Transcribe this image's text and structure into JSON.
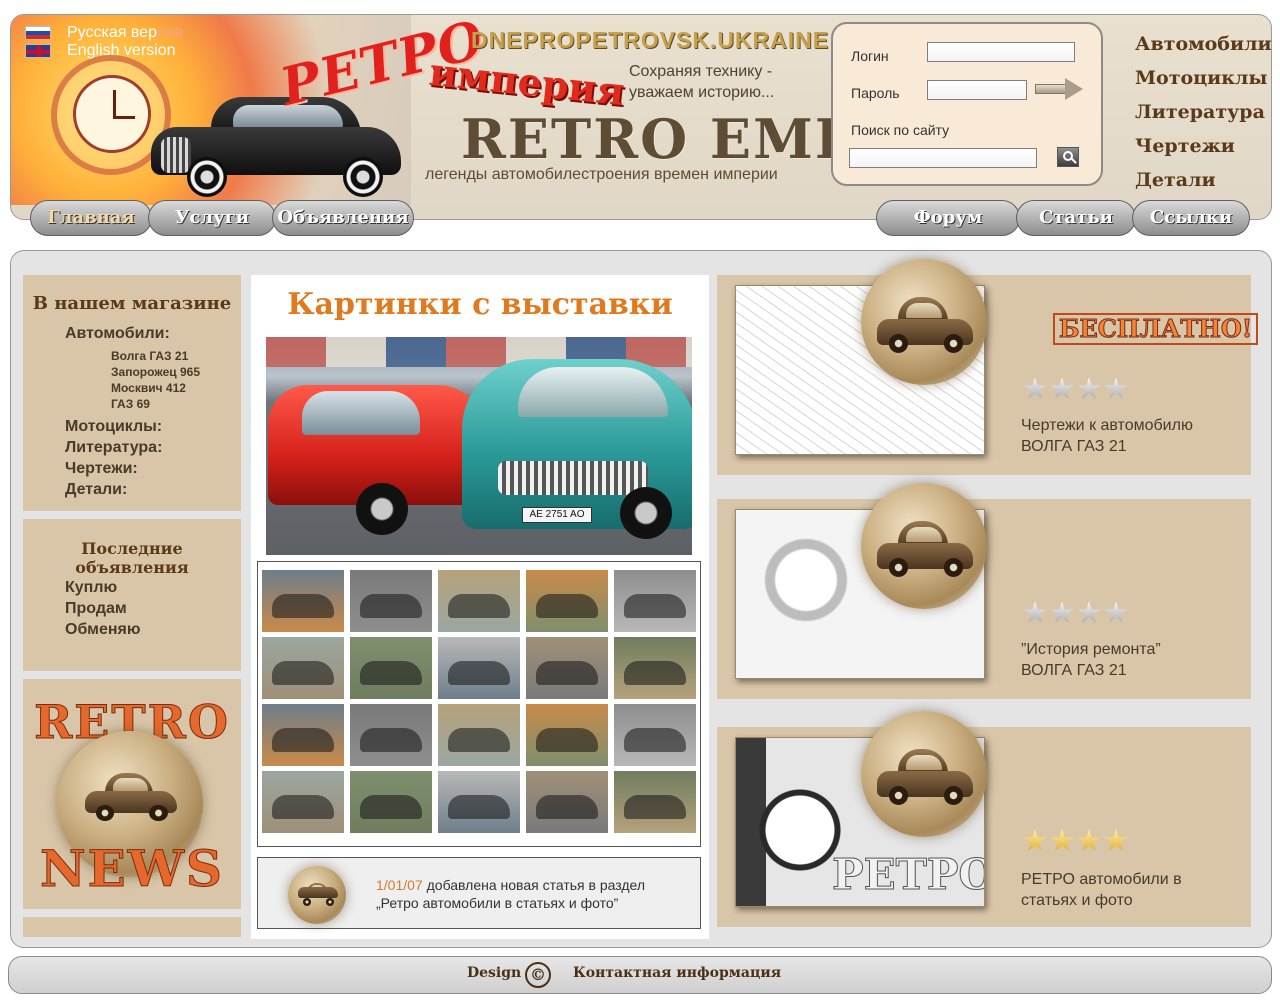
{
  "languages": [
    {
      "label": "Русская вер",
      "accent": "сия",
      "flag": "ru-flag-icon"
    },
    {
      "label": "English version",
      "accent": "",
      "flag": "uk-flag-icon"
    }
  ],
  "header": {
    "title_retro": "РЕТРО",
    "title_imperia": "империя",
    "location": "DNEPROPETROVSK.UKRAINE",
    "slogan_line1": "Сохраняя технику -",
    "slogan_line2": "уважаем историю...",
    "brand": "RETRO EMPIRE",
    "tagline": "легенды автомобилестроения времен империи"
  },
  "login": {
    "login_label": "Логин",
    "login_value": "",
    "password_label": "Пароль",
    "password_value": "",
    "search_label": "Поиск по сайту",
    "search_value": ""
  },
  "top_menu": [
    "Автомобили",
    "Мотоциклы",
    "Литература",
    "Чертежи",
    "Детали"
  ],
  "nav": {
    "left": [
      "Главная",
      "Услуги",
      "Объявления"
    ],
    "right": [
      "Форум",
      "Статьи",
      "Ссылки"
    ],
    "active": "Главная"
  },
  "shop": {
    "title": "В нашем магазине",
    "cars_label": "Автомобили:",
    "cars": [
      "Волга ГАЗ 21",
      "Запорожец 965",
      "Москвич 412",
      "ГАЗ 69"
    ],
    "categories": [
      "Мотоциклы:",
      "Литература:",
      "Чертежи:",
      "Детали:"
    ]
  },
  "ads": {
    "title": "Последние объявления",
    "items": [
      "Куплю",
      "Продам",
      "Обменяю"
    ]
  },
  "news_banner": {
    "top": "RETRO",
    "bottom": "NEWS"
  },
  "center": {
    "title": "Картинки с выставки",
    "photo_plate": "AE 2751 AO",
    "thumb_count": 20,
    "news_date": "1/01/07",
    "news_text_1": " добавлена новая статья в раздел",
    "news_text_2": "„Ретро автомобили в статьях и фото”"
  },
  "features": [
    {
      "badge": "БЕСПЛАТНО!",
      "line1": "Чертежи к автомобилю",
      "line2": "ВОЛГА ГАЗ 21",
      "stars": "gray",
      "image_text": ""
    },
    {
      "badge": "",
      "line1": "”История ремонта”",
      "line2": "ВОЛГА ГАЗ 21",
      "stars": "gray",
      "image_text": ""
    },
    {
      "badge": "",
      "line1": "РЕТРО автомобили в",
      "line2": "статьях и фото",
      "stars": "gold",
      "image_text": "РЕТРО"
    }
  ],
  "footer": {
    "design": "Design",
    "copyright": "©",
    "contact": "Контактная информация"
  },
  "colors": {
    "accent_orange": "#e07a1e",
    "panel_tan": "#d9c5a8",
    "brand_brown": "#5e4c35"
  }
}
